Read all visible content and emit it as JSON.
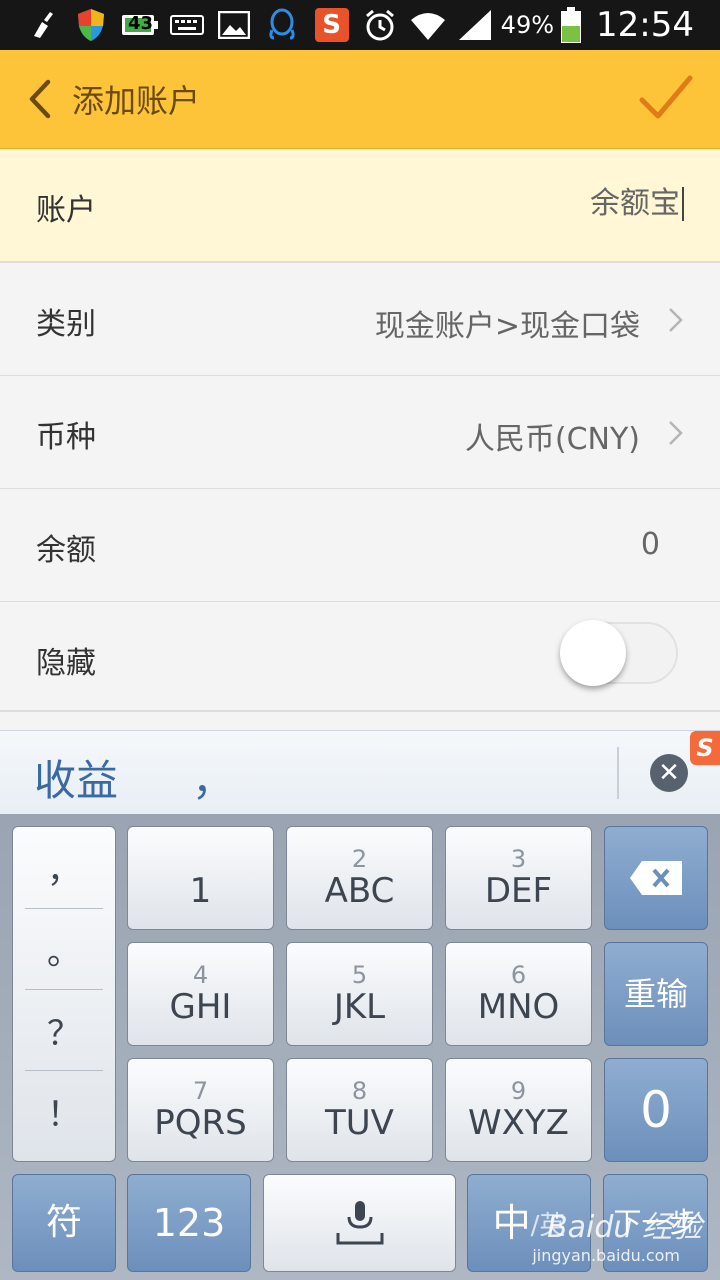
{
  "status_bar": {
    "battery_percent": "49%",
    "time": "12:54",
    "notification_badge": "43",
    "icons": [
      "cleaner-icon",
      "shield-icon",
      "battery-notification-icon",
      "keyboard-icon",
      "image-icon",
      "qq-icon",
      "sogou-icon",
      "alarm-icon",
      "wifi-icon",
      "signal-icon",
      "battery-icon"
    ]
  },
  "app_bar": {
    "title": "添加账户",
    "colors": {
      "background": "#fdc43a",
      "accent": "#e07b16"
    }
  },
  "form": {
    "account": {
      "label": "账户",
      "value": "余额宝"
    },
    "category": {
      "label": "类别",
      "value": "现金账户>现金口袋"
    },
    "currency": {
      "label": "币种",
      "value": "人民币(CNY)"
    },
    "balance": {
      "label": "余额",
      "value": "0"
    },
    "hidden": {
      "label": "隐藏",
      "on": false
    }
  },
  "candidates": {
    "first": "收益",
    "second": "，"
  },
  "keyboard": {
    "punctuation": [
      "，",
      "。",
      "？",
      "！"
    ],
    "keys": [
      {
        "num": "",
        "label": "1"
      },
      {
        "num": "2",
        "label": "ABC"
      },
      {
        "num": "3",
        "label": "DEF"
      },
      {
        "num": "4",
        "label": "GHI"
      },
      {
        "num": "5",
        "label": "JKL"
      },
      {
        "num": "6",
        "label": "MNO"
      },
      {
        "num": "7",
        "label": "PQRS"
      },
      {
        "num": "8",
        "label": "TUV"
      },
      {
        "num": "9",
        "label": "WXYZ"
      }
    ],
    "reinput_label": "重输",
    "zero_label": "0",
    "symbols_label": "符",
    "numbers_label": "123",
    "lang_label_main": "中",
    "lang_label_sub": "/英",
    "next_label": "下一步"
  },
  "watermark": {
    "text": "Baidu 经验",
    "url": "jingyan.baidu.com"
  }
}
